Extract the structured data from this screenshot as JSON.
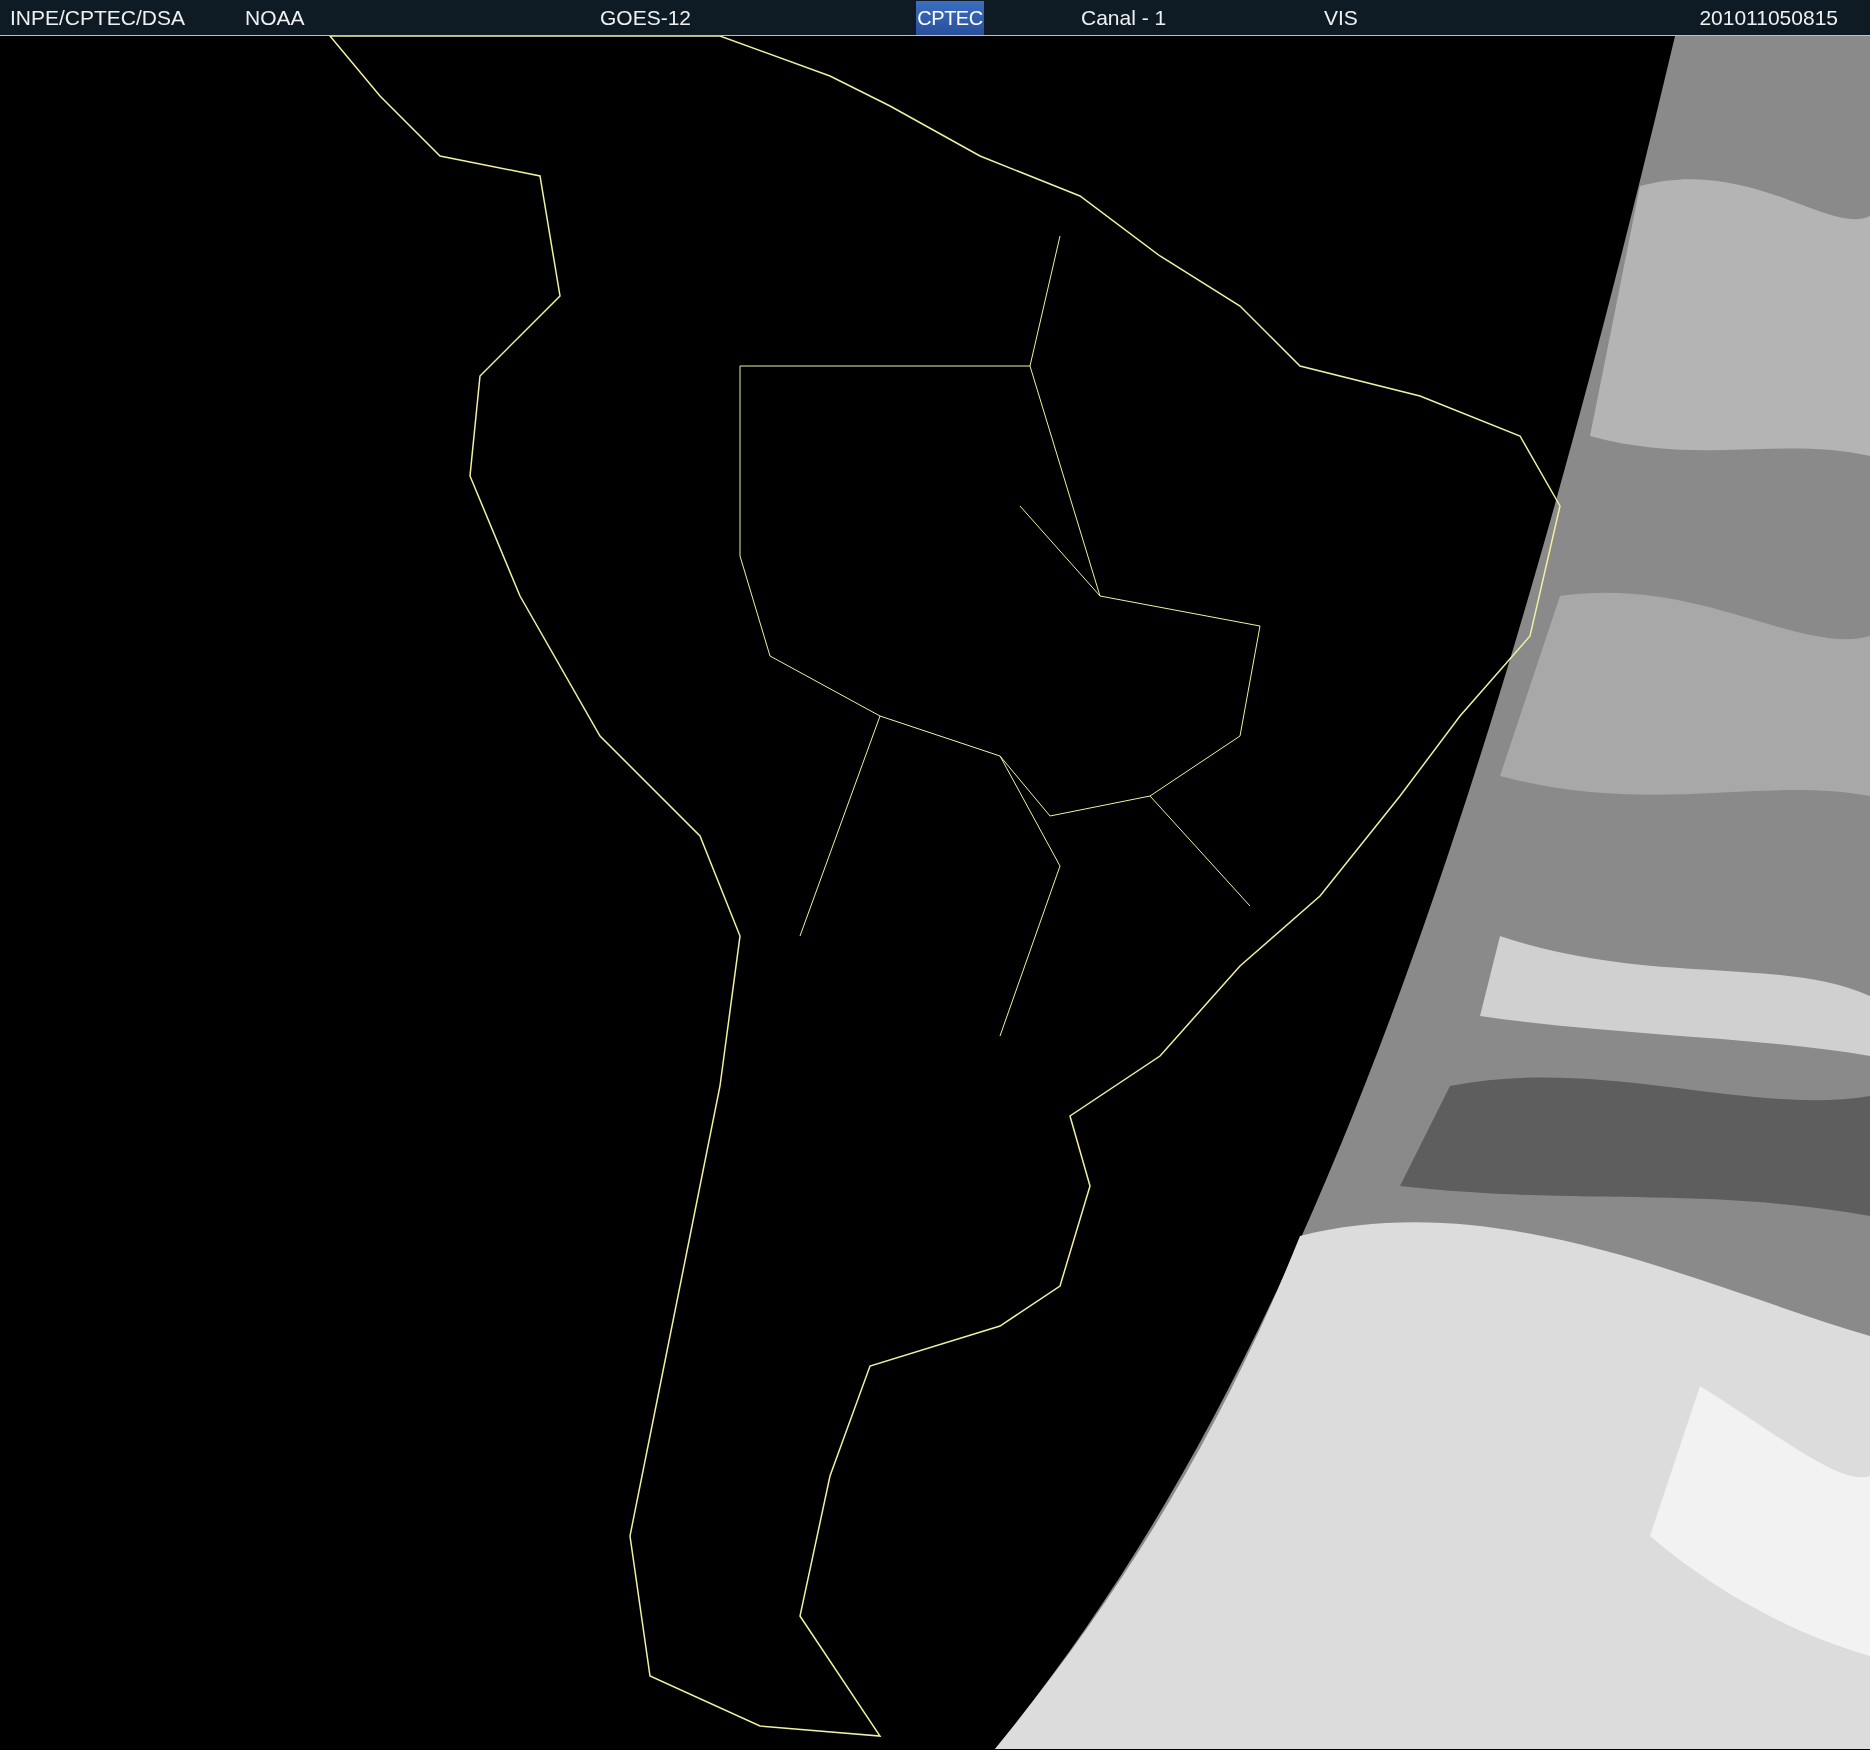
{
  "header": {
    "source": "INPE/CPTEC/DSA",
    "agency": "NOAA",
    "satellite": "GOES-12",
    "logo": "CPTEC",
    "channel": "Canal - 1",
    "band": "VIS",
    "timestamp": "201011050815"
  }
}
